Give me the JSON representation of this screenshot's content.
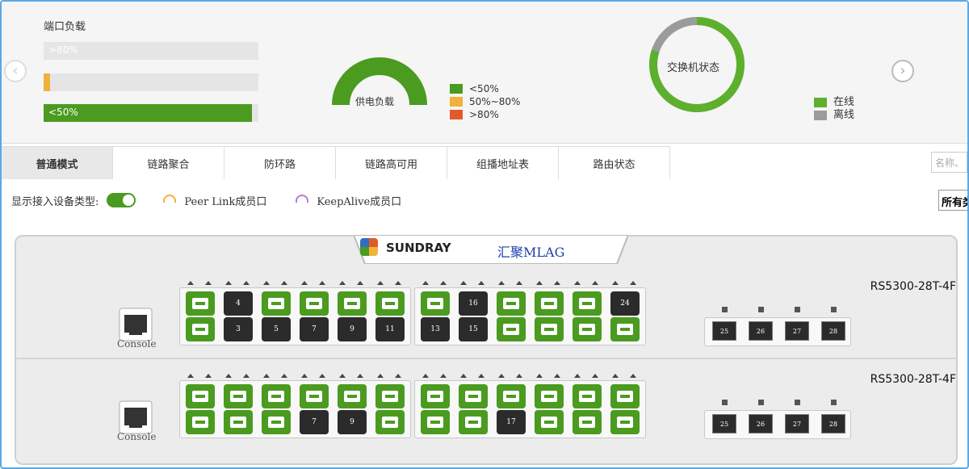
{
  "port_load": {
    "title": "端口负载",
    "bars": [
      {
        "label": ">80%",
        "fraction": 0.0,
        "color": "#e15b2a"
      },
      {
        "label": "",
        "fraction": 0.03,
        "color": "#f0b23a"
      },
      {
        "label": "<50%",
        "fraction": 0.97,
        "color": "#4a9b1f"
      }
    ]
  },
  "power": {
    "title": "供电负载",
    "legend": [
      {
        "label": "<50%",
        "color": "#4a9b1f"
      },
      {
        "label": "50%~80%",
        "color": "#f0b23a"
      },
      {
        "label": ">80%",
        "color": "#e15b2a"
      }
    ]
  },
  "switch_status": {
    "title": "交换机状态",
    "online_fraction": 0.8,
    "legend": [
      {
        "label": "在线",
        "color": "#5db02e"
      },
      {
        "label": "离线",
        "color": "#9b9b9b"
      }
    ]
  },
  "tabs": [
    "普通模式",
    "链路聚合",
    "防环路",
    "链路高可用",
    "组播地址表",
    "路由状态"
  ],
  "active_tab": 0,
  "search": {
    "placeholder": "名称、"
  },
  "options": {
    "show_device_type": "显示接入设备类型:",
    "peer_link": "Peer Link成员口",
    "keepalive": "KeepAlive成员口",
    "filter": "所有类"
  },
  "header": {
    "brand": "SUNDRAY",
    "group": "汇聚MLAG"
  },
  "switches": [
    {
      "model": "RS5300-28T-4F",
      "console": "Console",
      "top": [
        "g",
        "4",
        "g",
        "g",
        "g",
        "g",
        "g",
        "16",
        "g",
        "g",
        "g",
        "24"
      ],
      "bottom": [
        "g",
        "3",
        "5",
        "7",
        "9",
        "11",
        "13",
        "15",
        "g",
        "g",
        "g",
        "g"
      ],
      "sfp": [
        "25",
        "26",
        "27",
        "28"
      ]
    },
    {
      "model": "RS5300-28T-4F",
      "console": "Console",
      "top": [
        "g",
        "g",
        "g",
        "g",
        "g",
        "g",
        "g",
        "g",
        "g",
        "g",
        "g",
        "g"
      ],
      "bottom": [
        "g",
        "g",
        "g",
        "7",
        "9",
        "g",
        "g",
        "g",
        "17",
        "g",
        "g",
        "g"
      ],
      "sfp": [
        "25",
        "26",
        "27",
        "28"
      ]
    }
  ],
  "colors": {
    "accent": "#4a9b1f",
    "port_dark": "#2b2b2b",
    "peer_link": "#f0b23a",
    "keepalive": "#b57cd8"
  }
}
